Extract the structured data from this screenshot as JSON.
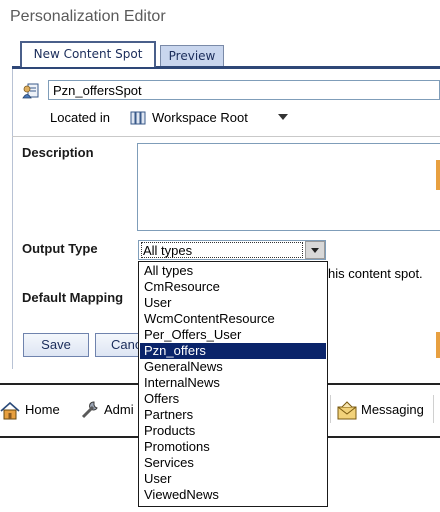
{
  "window": {
    "title": "Personalization Editor"
  },
  "tabs": [
    {
      "label": "New Content Spot"
    },
    {
      "label": "Preview"
    }
  ],
  "form": {
    "name_value": "Pzn_offersSpot",
    "location": {
      "label": "Located in",
      "value": "Workspace Root"
    },
    "description": {
      "label": "Description",
      "value": ""
    },
    "output_type": {
      "label": "Output Type",
      "selected": "All types",
      "hint": "his content spot.",
      "highlighted": "Pzn_offers",
      "options": [
        "All types",
        "CmResource",
        "User",
        "WcmContentResource",
        "Per_Offers_User",
        "Pzn_offers",
        "GeneralNews",
        "InternalNews",
        "Offers",
        "Partners",
        "Products",
        "Promotions",
        "Services",
        "User",
        "ViewedNews"
      ]
    },
    "default_mapping": {
      "label": "Default Mapping"
    }
  },
  "buttons": {
    "save": "Save",
    "cancel": "Cancel"
  },
  "nav": {
    "home": "Home",
    "admin": "Admi",
    "messaging": "Messaging"
  },
  "colors": {
    "accent": "#0a246a",
    "tab_border": "#2e4777",
    "orange": "#e8a040"
  }
}
